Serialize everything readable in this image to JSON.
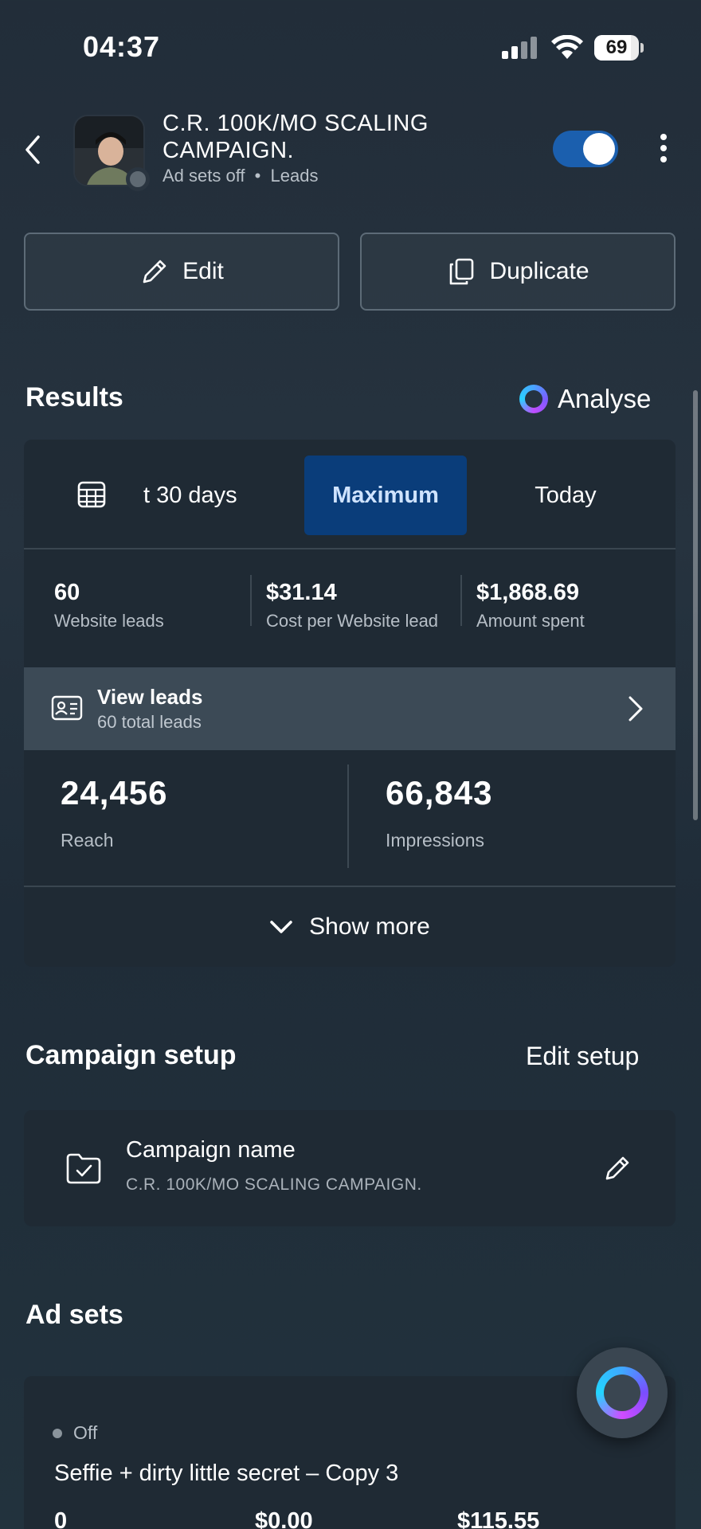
{
  "status_bar": {
    "time": "04:37",
    "battery": "69"
  },
  "header": {
    "title": "C.R. 100K/MO SCALING CAMPAIGN.",
    "status": "Ad sets off",
    "separator": "•",
    "objective": "Leads",
    "toggle_on": true
  },
  "actions": {
    "edit_label": "Edit",
    "duplicate_label": "Duplicate"
  },
  "results": {
    "title": "Results",
    "analyse_label": "Analyse",
    "tabs": [
      {
        "label": "t 30 days",
        "active": false
      },
      {
        "label": "Maximum",
        "active": true
      },
      {
        "label": "Today",
        "active": false
      }
    ],
    "metrics": [
      {
        "value": "60",
        "label": "Website leads"
      },
      {
        "value": "$31.14",
        "label": "Cost per Website lead"
      },
      {
        "value": "$1,868.69",
        "label": "Amount spent"
      }
    ],
    "view_leads": {
      "title": "View leads",
      "subtitle": "60 total leads"
    },
    "stats": [
      {
        "value": "24,456",
        "label": "Reach"
      },
      {
        "value": "66,843",
        "label": "Impressions"
      }
    ],
    "show_more_label": "Show more"
  },
  "campaign_setup": {
    "title": "Campaign setup",
    "edit_label": "Edit setup",
    "name_label": "Campaign name",
    "name_value": "C.R. 100K/MO SCALING CAMPAIGN."
  },
  "ad_sets": {
    "title": "Ad sets",
    "items": [
      {
        "status": "Off",
        "name": "Seffie + dirty little secret – Copy 3",
        "metrics": [
          "0",
          "$0.00",
          "$115.55"
        ]
      }
    ]
  },
  "colors": {
    "accent": "#1b5fae",
    "active_tab": "#0a3d7a"
  }
}
